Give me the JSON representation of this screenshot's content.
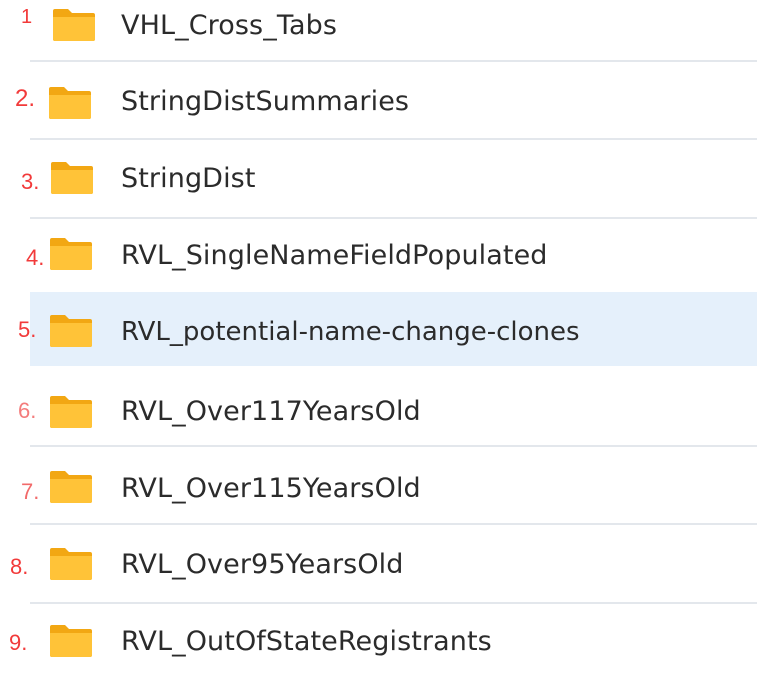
{
  "folders": [
    {
      "number": "1",
      "name": "VHL_Cross_Tabs",
      "icon": "folder-icon",
      "selected": false
    },
    {
      "number": "2.",
      "name": "StringDistSummaries",
      "icon": "folder-icon",
      "selected": false
    },
    {
      "number": "3.",
      "name": "StringDist",
      "icon": "folder-icon",
      "selected": false
    },
    {
      "number": "4.",
      "name": "RVL_SingleNameFieldPopulated",
      "icon": "folder-icon",
      "selected": false
    },
    {
      "number": "5.",
      "name": "RVL_potential-name-change-clones",
      "icon": "folder-icon",
      "selected": true
    },
    {
      "number": "6.",
      "name": "RVL_Over117YearsOld",
      "icon": "folder-icon",
      "selected": false
    },
    {
      "number": "7.",
      "name": "RVL_Over115YearsOld",
      "icon": "folder-icon",
      "selected": false
    },
    {
      "number": "8.",
      "name": "RVL_Over95YearsOld",
      "icon": "folder-icon",
      "selected": false
    },
    {
      "number": "9.",
      "name": "RVL_OutOfStateRegistrants",
      "icon": "folder-icon",
      "selected": false
    }
  ],
  "colors": {
    "folder": "#ffc338",
    "folder_back": "#f2a713",
    "annotation": "#f23a3a",
    "selection": "#e5f0fb",
    "text": "#2b2b2b"
  }
}
